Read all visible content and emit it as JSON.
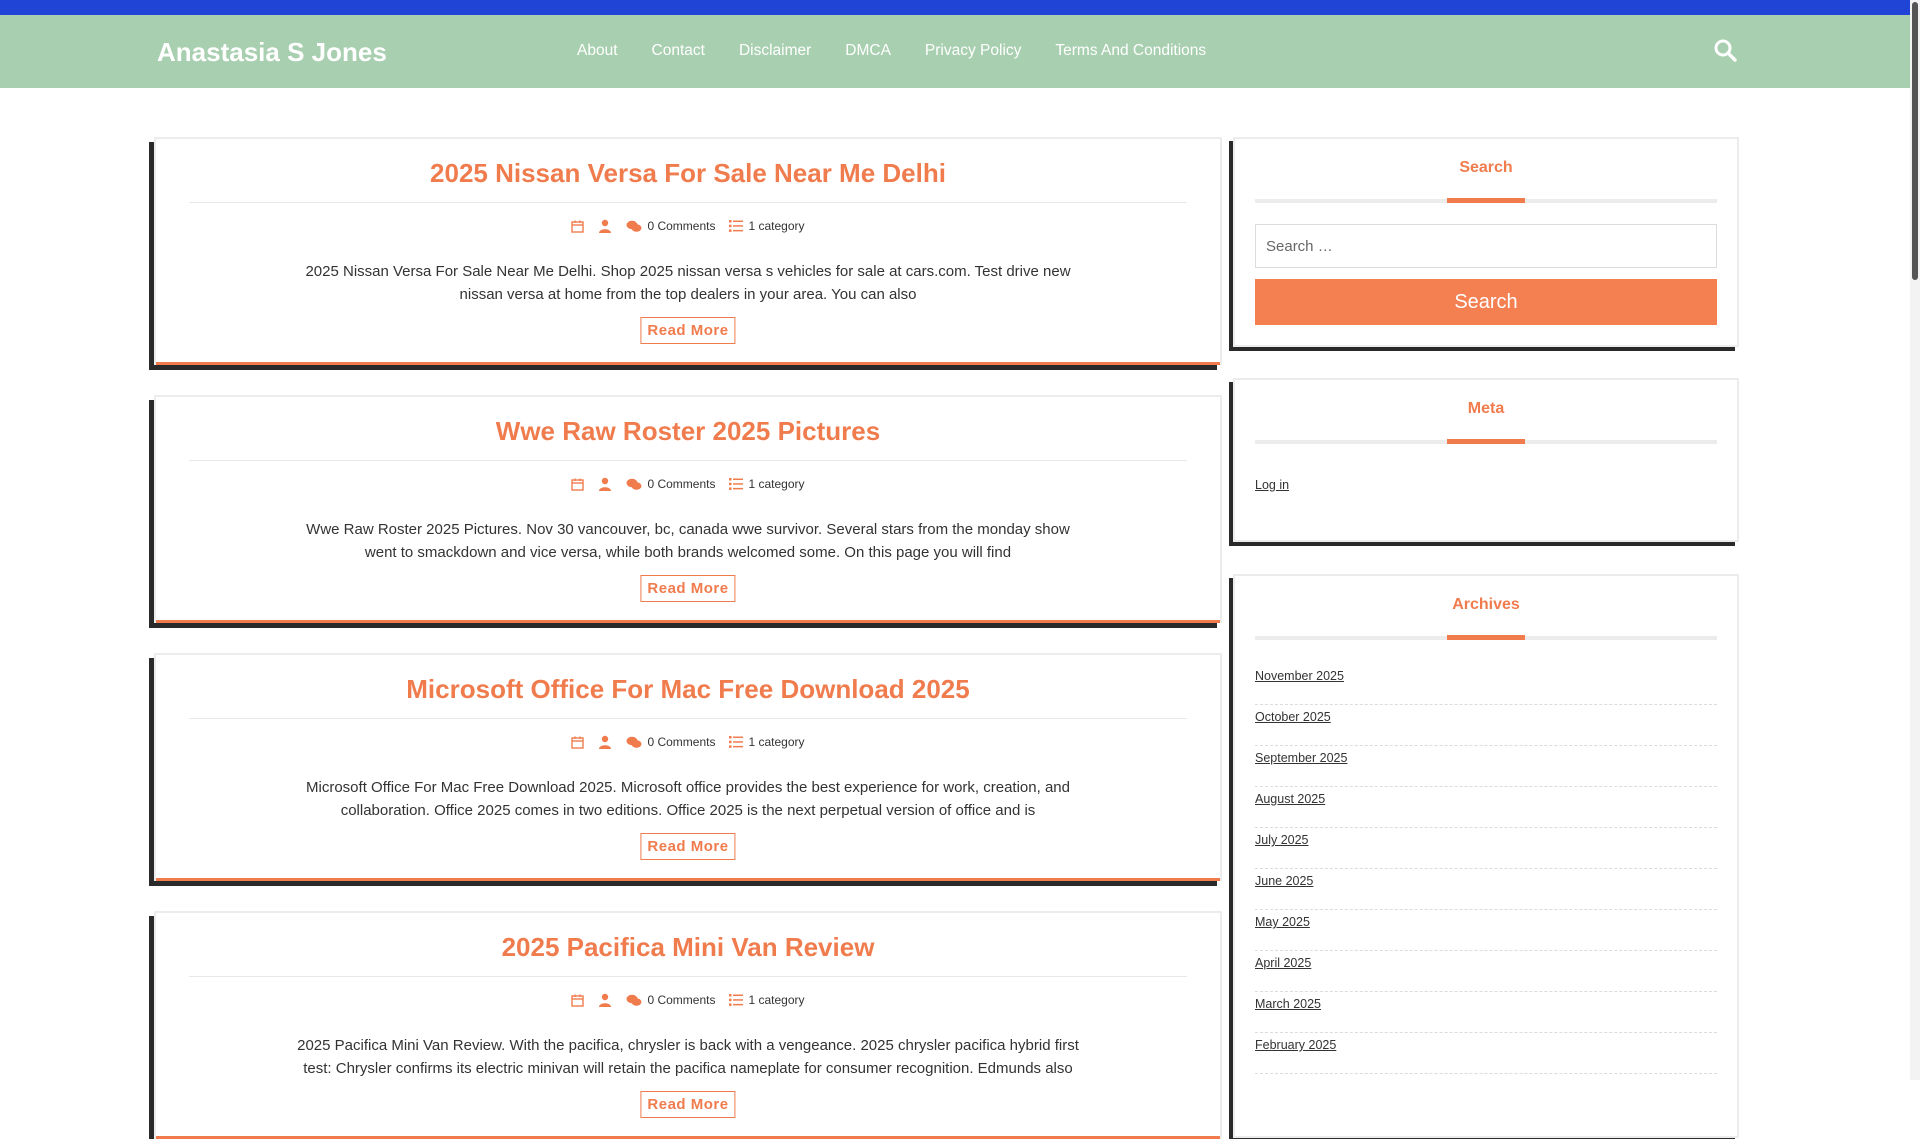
{
  "site": {
    "title": "Anastasia S Jones"
  },
  "nav": {
    "items": [
      "About",
      "Contact",
      "Disclaimer",
      "DMCA",
      "Privacy Policy",
      "Terms And Conditions"
    ],
    "search_icon": "search-icon"
  },
  "colors": {
    "topbar": "#1f44d6",
    "header": "#a8cfb0",
    "accent": "#f07c4e"
  },
  "posts": [
    {
      "title": "2025 Nissan Versa For Sale Near Me Delhi",
      "comments": "0 Comments",
      "category": "1 category",
      "excerpt": "2025 Nissan Versa For Sale Near Me Delhi. Shop 2025 nissan versa s vehicles for sale at cars.com. Test drive new nissan versa at home from the top dealers in your area. You can also",
      "read_more": "Read More"
    },
    {
      "title": "Wwe Raw Roster 2025 Pictures",
      "comments": "0 Comments",
      "category": "1 category",
      "excerpt": "Wwe Raw Roster 2025 Pictures. Nov 30 vancouver, bc, canada wwe survivor. Several stars from the monday show went to smackdown and vice versa, while both brands welcomed some. On this page you will find",
      "read_more": "Read More"
    },
    {
      "title": "Microsoft Office For Mac Free Download 2025",
      "comments": "0 Comments",
      "category": "1 category",
      "excerpt": "Microsoft Office For Mac Free Download 2025. Microsoft office provides the best experience for work, creation, and collaboration. Office 2025 comes in two editions. Office 2025 is the next perpetual version of office and is",
      "read_more": "Read More"
    },
    {
      "title": "2025 Pacifica Mini Van Review",
      "comments": "0 Comments",
      "category": "1 category",
      "excerpt": "2025 Pacifica Mini Van Review. With the pacifica, chrysler is back with a vengeance. 2025 chrysler pacifica hybrid first test: Chrysler confirms its electric minivan will retain the pacifica nameplate for consumer recognition. Edmunds also",
      "read_more": "Read More"
    }
  ],
  "sidebar": {
    "search": {
      "title": "Search",
      "placeholder": "Search …",
      "button": "Search"
    },
    "meta": {
      "title": "Meta",
      "login": "Log in"
    },
    "archives": {
      "title": "Archives",
      "items": [
        "November 2025",
        "October 2025",
        "September 2025",
        "August 2025",
        "July 2025",
        "June 2025",
        "May 2025",
        "April 2025",
        "March 2025",
        "February 2025"
      ]
    }
  }
}
